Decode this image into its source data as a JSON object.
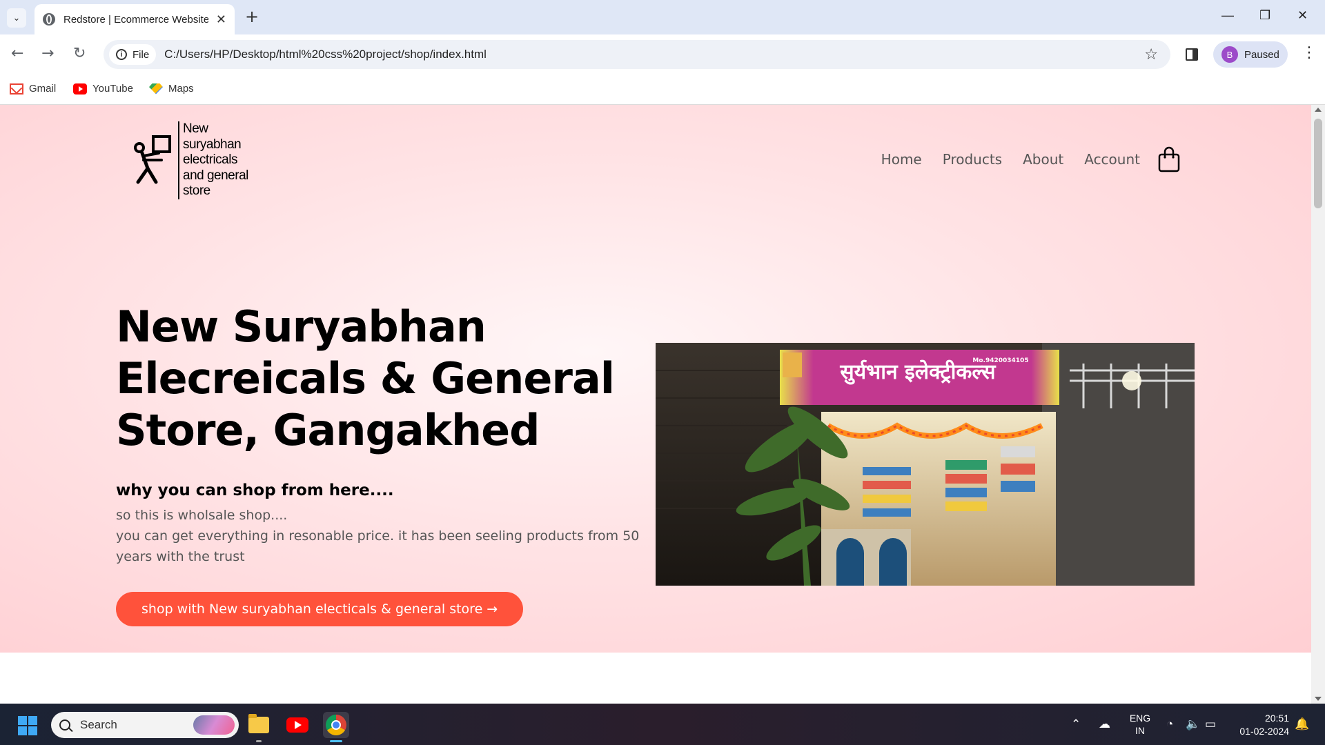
{
  "browser": {
    "tab_title": "Redstore | Ecommerce Website",
    "new_tab": "+",
    "address_chip": "File",
    "url": "C:/Users/HP/Desktop/html%20css%20project/shop/index.html",
    "profile_initial": "B",
    "profile_status": "Paused",
    "bookmarks": [
      {
        "label": "Gmail",
        "icon": "gmail-icon"
      },
      {
        "label": "YouTube",
        "icon": "youtube-icon"
      },
      {
        "label": "Maps",
        "icon": "maps-icon"
      }
    ]
  },
  "site": {
    "logo_text": "New\nsuryabhan\nelectricals\nand general\nstore",
    "menu": [
      "Home",
      "Products",
      "About",
      "Account"
    ],
    "hero": {
      "title": "New Suryabhan Elecreicals & General Store, Gangakhed",
      "subtitle": "why you can shop from here....",
      "desc_line1": "so this is wholsale shop....",
      "desc_line2": "you can get everything in resonable price. it has been seeling products from 50 years with the trust",
      "cta": "shop with New suryabhan electicals & general store →"
    },
    "photo": {
      "sign_main": "सुर्यभान इलेक्ट्रीकल्स",
      "sign_phone": "Mo.9420034105"
    }
  },
  "taskbar": {
    "search_label": "Search",
    "lang_top": "ENG",
    "lang_bottom": "IN",
    "time": "20:51",
    "date": "01-02-2024"
  },
  "colors": {
    "accent": "#ff523b",
    "hero_bg": "#ffe3e5",
    "tabbar_bg": "#dfe7f6"
  }
}
